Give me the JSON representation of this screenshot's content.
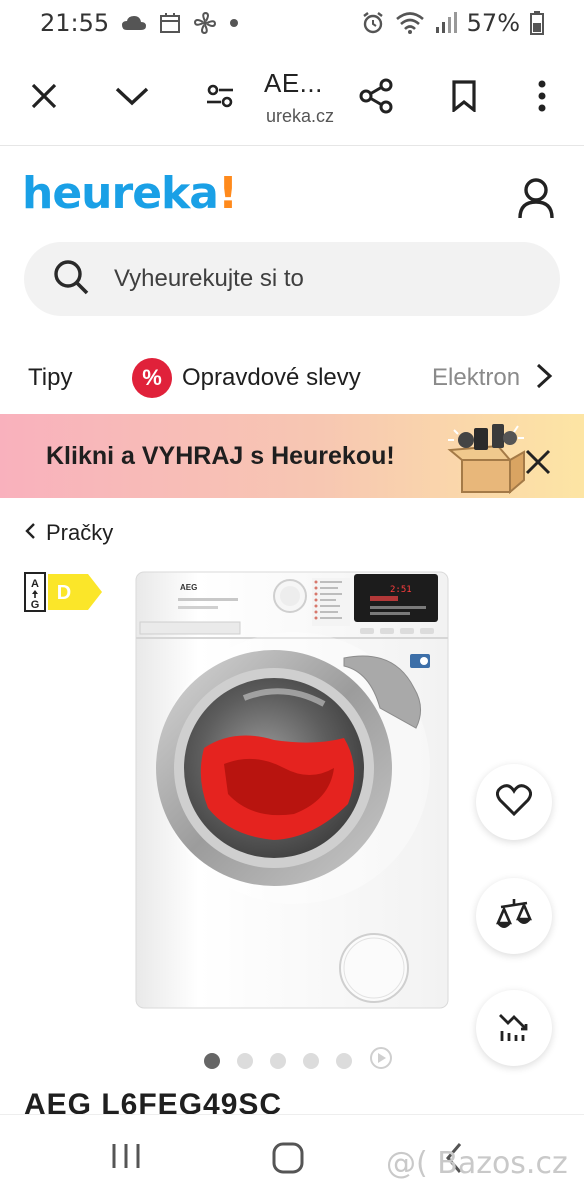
{
  "status_bar": {
    "time": "21:55",
    "battery": "57%",
    "icons": [
      "cloud-icon",
      "calendar-icon",
      "fan-icon",
      "dot-icon",
      "alarm-icon",
      "wifi-icon",
      "signal-icon",
      "battery-icon"
    ]
  },
  "browser": {
    "title": "AE...",
    "url": "ureka.cz",
    "icons": [
      "close-icon",
      "chevron-down-icon",
      "tune-icon",
      "share-icon",
      "bookmark-icon",
      "more-icon"
    ]
  },
  "header": {
    "logo_text": "heureka",
    "logo_bang": "!",
    "colors": {
      "logo": "#1aa0e6",
      "accent": "#ff8a1c"
    }
  },
  "search": {
    "placeholder": "Vyheurekujte si to"
  },
  "categories": {
    "items": [
      {
        "label": "Tipy"
      },
      {
        "label": "Opravdové slevy",
        "badge": "%"
      },
      {
        "label": "Elektron"
      }
    ]
  },
  "promo": {
    "text": "Klikni a VYHRAJ s Heurekou!"
  },
  "breadcrumb": {
    "label": "Pračky"
  },
  "energy_label": {
    "scale_top": "A",
    "scale_bottom": "G",
    "class": "D",
    "color": "#fbe629"
  },
  "product": {
    "brand_on_image": "AEG",
    "display_text": "2:51",
    "title": "AEG L6FEG49SC"
  },
  "carousel": {
    "count": 5,
    "active_index": 0
  },
  "watermark": "@( Bazos.cz"
}
